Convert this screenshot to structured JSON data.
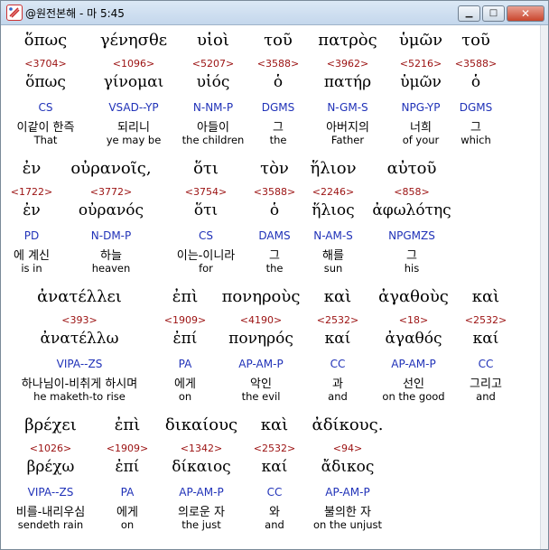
{
  "window": {
    "title": "@원전본해 - 마 5:45",
    "minimize_label": "▁",
    "maximize_label": "□",
    "close_label": "✕"
  },
  "rows": [
    {
      "words": [
        {
          "greek": "ὅπως",
          "strong": "<3704>",
          "lemma": "ὅπως",
          "parse": "CS",
          "korean": "이같이 한즉",
          "english": "That"
        },
        {
          "greek": "γένησθε",
          "strong": "<1096>",
          "lemma": "γίνομαι",
          "parse": "VSAD--YP",
          "korean": "되리니",
          "english": "ye may be"
        },
        {
          "greek": "υἱοὶ",
          "strong": "<5207>",
          "lemma": "υἱός",
          "parse": "N-NM-P",
          "korean": "아들이",
          "english": "the children"
        },
        {
          "greek": "τοῦ",
          "strong": "<3588>",
          "lemma": "ὁ",
          "parse": "DGMS",
          "korean": "그",
          "english": "the"
        },
        {
          "greek": "πατρὸς",
          "strong": "<3962>",
          "lemma": "πατήρ",
          "parse": "N-GM-S",
          "korean": "아버지의",
          "english": "Father"
        },
        {
          "greek": "ὑμῶν",
          "strong": "<5216>",
          "lemma": "ὑμῶν",
          "parse": "NPG-YP",
          "korean": "너희",
          "english": "of your"
        },
        {
          "greek": "τοῦ",
          "strong": "<3588>",
          "lemma": "ὁ",
          "parse": "DGMS",
          "korean": "그",
          "english": "which"
        }
      ]
    },
    {
      "words": [
        {
          "greek": "ἐν",
          "strong": "<1722>",
          "lemma": "ἐν",
          "parse": "PD",
          "korean": "에 계신",
          "english": "is in"
        },
        {
          "greek": "οὐρανοῖς,",
          "strong": "<3772>",
          "lemma": "οὐρανός",
          "parse": "N-DM-P",
          "korean": "하늘",
          "english": "heaven"
        },
        {
          "greek": "ὅτι",
          "strong": "<3754>",
          "lemma": "ὅτι",
          "parse": "CS",
          "korean": "이는-이니라",
          "english": "for"
        },
        {
          "greek": "τὸν",
          "strong": "<3588>",
          "lemma": "ὁ",
          "parse": "DAMS",
          "korean": "그",
          "english": "the"
        },
        {
          "greek": "ἥλιον",
          "strong": "<2246>",
          "lemma": "ἥλιος",
          "parse": "N-AM-S",
          "korean": "해를",
          "english": "sun"
        },
        {
          "greek": "αὐτοῦ",
          "strong": "<858>",
          "lemma": "ἀφωλότης",
          "parse": "NPGMZS",
          "korean": "그",
          "english": "his"
        }
      ]
    },
    {
      "words": [
        {
          "greek": "ἀνατέλλει",
          "strong": "<393>",
          "lemma": "ἀνατέλλω",
          "parse": "VIPA--ZS",
          "korean": "하나님이-비취게 하시며",
          "english": "he maketh-to rise"
        },
        {
          "greek": "ἐπὶ",
          "strong": "<1909>",
          "lemma": "ἐπί",
          "parse": "PA",
          "korean": "에게",
          "english": "on"
        },
        {
          "greek": "πονηροὺς",
          "strong": "<4190>",
          "lemma": "πονηρός",
          "parse": "AP-AM-P",
          "korean": "악인",
          "english": "the evil"
        },
        {
          "greek": "καὶ",
          "strong": "<2532>",
          "lemma": "καί",
          "parse": "CC",
          "korean": "과",
          "english": "and"
        },
        {
          "greek": "ἀγαθοὺς",
          "strong": "<18>",
          "lemma": "ἀγαθός",
          "parse": "AP-AM-P",
          "korean": "선인",
          "english": "on the good"
        },
        {
          "greek": "καὶ",
          "strong": "<2532>",
          "lemma": "καί",
          "parse": "CC",
          "korean": "그리고",
          "english": "and"
        }
      ]
    },
    {
      "words": [
        {
          "greek": "βρέχει",
          "strong": "<1026>",
          "lemma": "βρέχω",
          "parse": "VIPA--ZS",
          "korean": "비를-내리우심",
          "english": "sendeth rain"
        },
        {
          "greek": "ἐπὶ",
          "strong": "<1909>",
          "lemma": "ἐπί",
          "parse": "PA",
          "korean": "에게",
          "english": "on"
        },
        {
          "greek": "δικαίους",
          "strong": "<1342>",
          "lemma": "δίκαιος",
          "parse": "AP-AM-P",
          "korean": "의로운 자",
          "english": "the just"
        },
        {
          "greek": "καὶ",
          "strong": "<2532>",
          "lemma": "καί",
          "parse": "CC",
          "korean": "와",
          "english": "and"
        },
        {
          "greek": "ἀδίκους.",
          "strong": "<94>",
          "lemma": "ἄδικος",
          "parse": "AP-AM-P",
          "korean": "불의한 자",
          "english": "on the unjust"
        }
      ]
    }
  ]
}
